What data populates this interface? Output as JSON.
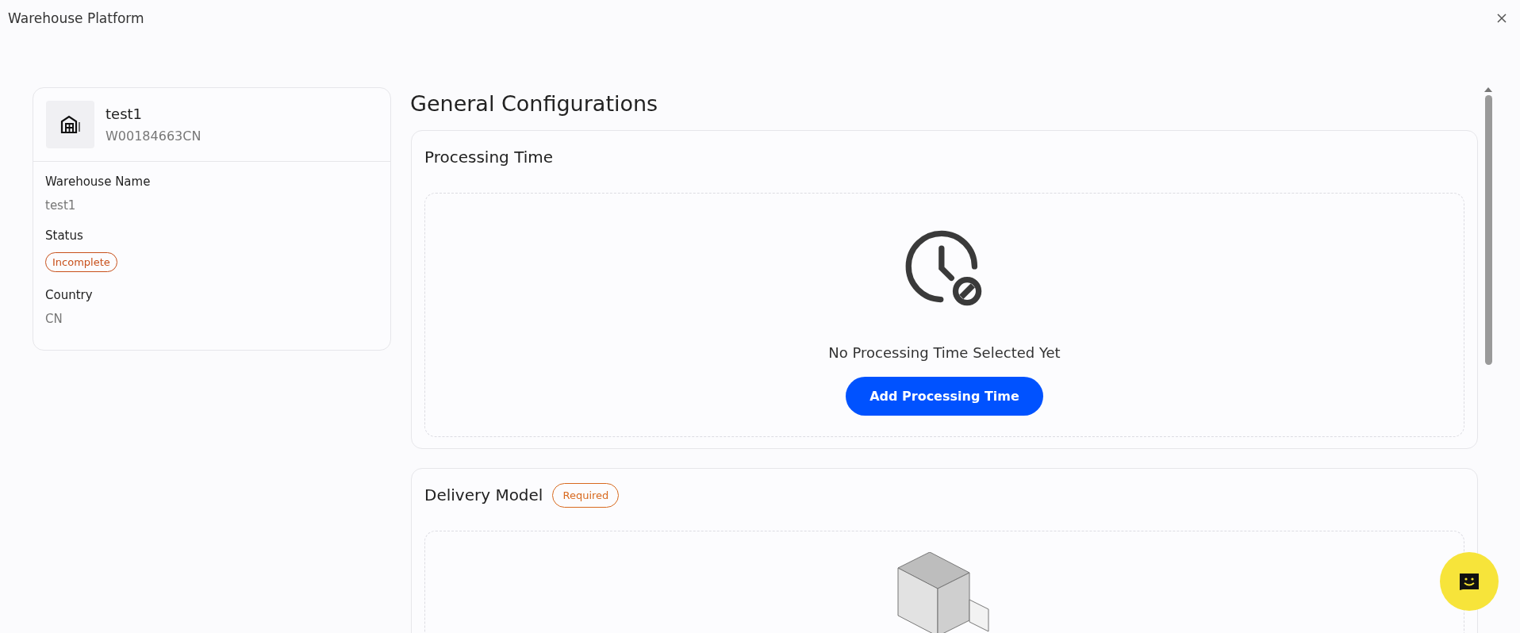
{
  "window": {
    "title": "Warehouse Platform"
  },
  "warehouse_card": {
    "name": "test1",
    "code": "W00184663CN",
    "fields": [
      {
        "label": "Warehouse Name",
        "kind": "text",
        "value": "test1"
      },
      {
        "label": "Status",
        "kind": "status",
        "value": "Incomplete"
      },
      {
        "label": "Country",
        "kind": "text",
        "value": "CN"
      }
    ]
  },
  "main": {
    "title": "General Configurations",
    "sections": [
      {
        "title": "Processing Time",
        "kind": "empty",
        "message": "No Processing Time Selected Yet",
        "button": "Add Processing Time"
      },
      {
        "title": "Delivery Model",
        "kind": "illustration",
        "badge": "Required"
      }
    ]
  }
}
